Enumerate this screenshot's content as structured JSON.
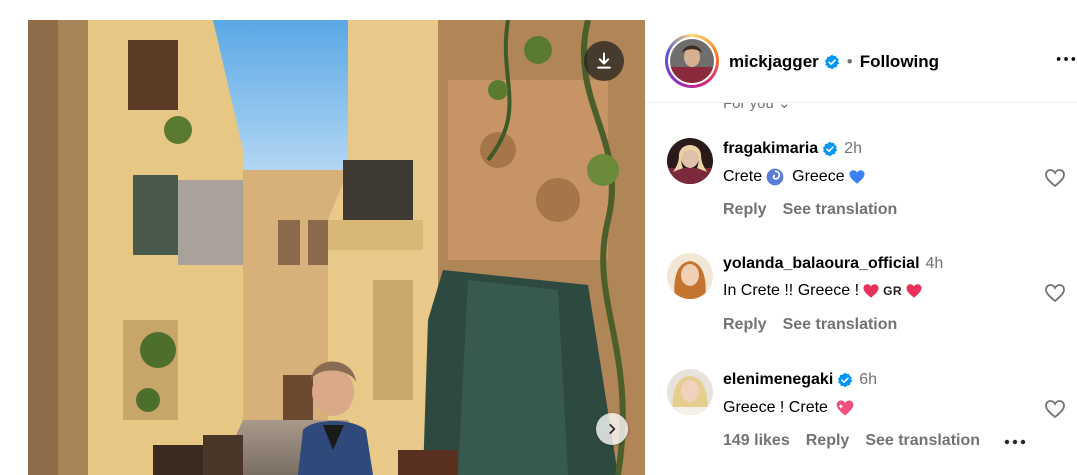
{
  "post": {
    "photo_alt": "Narrow alley street photo",
    "download_icon": "download-icon",
    "next_icon": "chevron-right-icon"
  },
  "header": {
    "username": "mickjagger",
    "separator": "•",
    "follow_status": "Following",
    "more_icon": "more-horizontal-icon"
  },
  "for_you": "For you",
  "comments": [
    {
      "username": "fragakimaria",
      "verified": true,
      "time": "2h",
      "text_parts": [
        "Crete",
        "Greece"
      ],
      "reply_label": "Reply",
      "translate_label": "See translation"
    },
    {
      "username": "yolanda_balaoura_official",
      "verified": false,
      "time": "4h",
      "text_parts": [
        "In Crete !! Greece !",
        "GR"
      ],
      "reply_label": "Reply",
      "translate_label": "See translation"
    },
    {
      "username": "elenimenegaki",
      "verified": true,
      "time": "6h",
      "text_parts": [
        "Greece ! Crete"
      ],
      "likes_label": "149 likes",
      "reply_label": "Reply",
      "translate_label": "See translation"
    }
  ],
  "colors": {
    "verified_blue": "#0095f6",
    "muted_text": "#737373",
    "heart_red": "#e8305a",
    "blue_heart": "#3b82f6"
  }
}
